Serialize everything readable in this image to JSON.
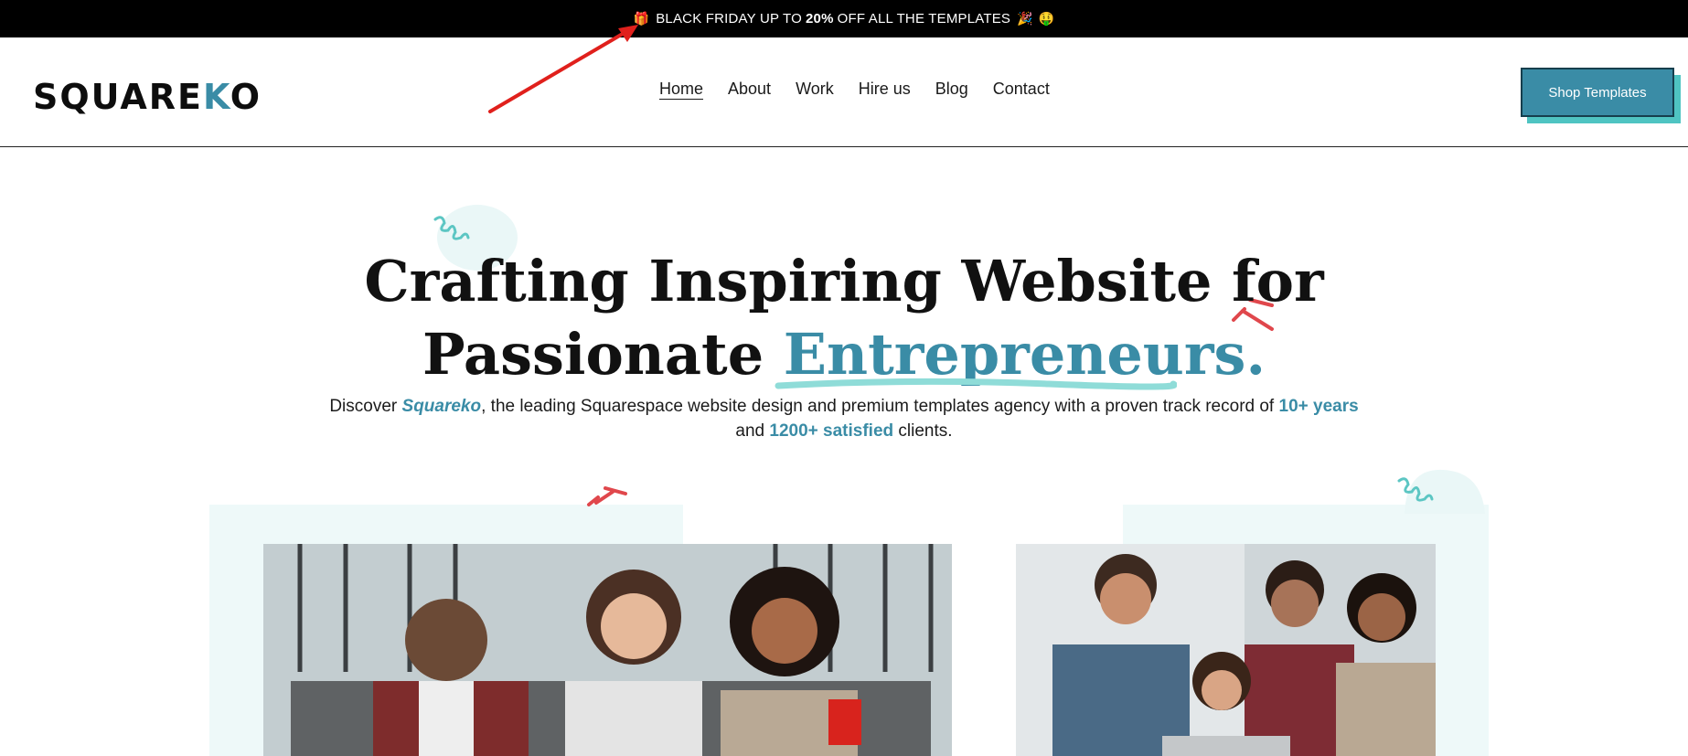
{
  "announcement": {
    "text_before": "BLACK FRIDAY UP TO",
    "highlight": "20%",
    "text_after": "OFF ALL THE TEMPLATES"
  },
  "header": {
    "logo_main": "SQUARE",
    "logo_accent": "K",
    "logo_end": "O",
    "nav": [
      "Home",
      "About",
      "Work",
      "Hire us",
      "Blog",
      "Contact"
    ],
    "cta_label": "Shop Templates"
  },
  "hero": {
    "title_line1": "Crafting Inspiring Website for",
    "title_line2_plain": "Passionate",
    "title_line2_accent": "Entrepreneurs.",
    "sub_discover": "Discover",
    "sub_brand": "Squareko",
    "sub_middle": ", the leading Squarespace website design and premium templates agency with a proven track record of",
    "sub_years": "10+ years",
    "sub_and": "and",
    "sub_clients": "1200+ satisfied",
    "sub_end": "clients."
  },
  "colors": {
    "accent": "#3a8ca6",
    "cta_shadow": "#4fc4c2",
    "annotation_arrow": "#e0201c",
    "deco_red": "#e0474c"
  }
}
